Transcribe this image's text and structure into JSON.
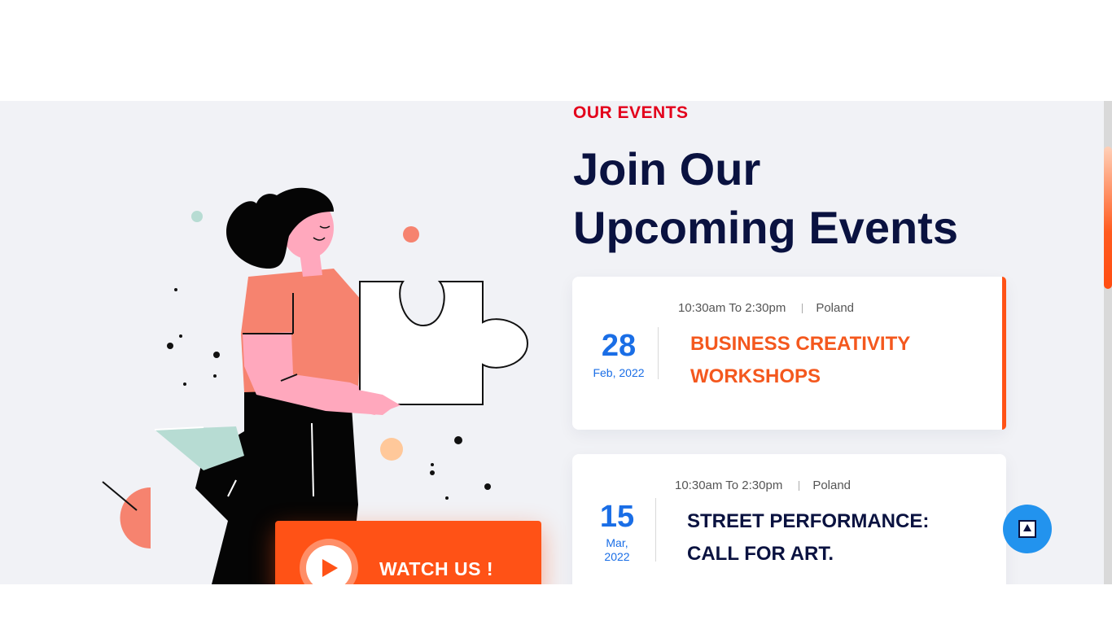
{
  "section": {
    "eyebrow": "OUR EVENTS",
    "heading_line1": "Join Our",
    "heading_line2": "Upcoming Events"
  },
  "watch_button": {
    "label": "WATCH US !",
    "icon": "play-icon"
  },
  "events": [
    {
      "time": "10:30am To 2:30pm",
      "location": "Poland",
      "day": "28",
      "month_year": "Feb, 2022",
      "title_line1": "BUSINESS CREATIVITY",
      "title_line2": "WORKSHOPS",
      "active": true
    },
    {
      "time": "10:30am To 2:30pm",
      "location": "Poland",
      "day": "15",
      "month_line1": "Mar,",
      "month_line2": "2022",
      "title_line1": "STREET PERFORMANCE:",
      "title_line2": "CALL FOR ART.",
      "active": false
    }
  ],
  "scroll_top": {
    "icon": "arrow-up-icon"
  },
  "colors": {
    "accent": "#ff5216",
    "eyebrow": "#e3001b",
    "navy": "#0a1240",
    "date_blue": "#1a6ee6",
    "scroll_button": "#2293ee"
  }
}
